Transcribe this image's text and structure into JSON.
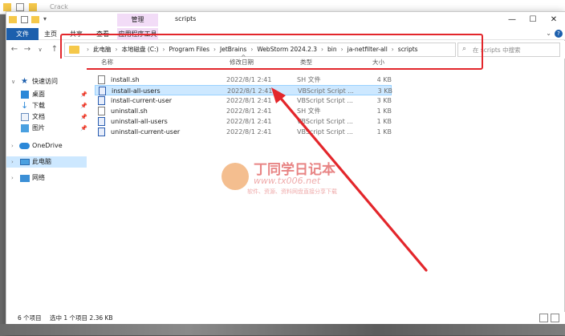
{
  "background_window": {
    "title": "Crack"
  },
  "titlebar": {
    "manage_tab": "管理",
    "title": "scripts",
    "minimize": "—",
    "maximize": "☐",
    "close": "✕"
  },
  "ribbon": {
    "tabs": [
      "文件",
      "主页",
      "共享",
      "查看",
      "应用程序工具"
    ],
    "help": "?",
    "expand": "⌄"
  },
  "address": {
    "breadcrumbs": [
      "此电脑",
      "本地磁盘 (C:)",
      "Program Files",
      "JetBrains",
      "WebStorm 2024.2.3",
      "bin",
      "ja-netfilter-all",
      "scripts"
    ],
    "search_placeholder": "在 scripts 中搜索"
  },
  "columns": {
    "name": "名称",
    "date": "修改日期",
    "type": "类型",
    "size": "大小"
  },
  "files": [
    {
      "name": "install.sh",
      "date": "2022/8/1 2:41",
      "type": "SH 文件",
      "size": "4 KB",
      "kind": "sh",
      "selected": false
    },
    {
      "name": "install-all-users",
      "date": "2022/8/1 2:41",
      "type": "VBScript Script ...",
      "size": "3 KB",
      "kind": "vbs",
      "selected": true
    },
    {
      "name": "install-current-user",
      "date": "2022/8/1 2:41",
      "type": "VBScript Script ...",
      "size": "3 KB",
      "kind": "vbs",
      "selected": false
    },
    {
      "name": "uninstall.sh",
      "date": "2022/8/1 2:41",
      "type": "SH 文件",
      "size": "1 KB",
      "kind": "sh",
      "selected": false
    },
    {
      "name": "uninstall-all-users",
      "date": "2022/8/1 2:41",
      "type": "VBScript Script ...",
      "size": "1 KB",
      "kind": "vbs",
      "selected": false
    },
    {
      "name": "uninstall-current-user",
      "date": "2022/8/1 2:41",
      "type": "VBScript Script ...",
      "size": "1 KB",
      "kind": "vbs",
      "selected": false
    }
  ],
  "nav": {
    "quick_access": "快速访问",
    "desktop": "桌面",
    "downloads": "下载",
    "documents": "文档",
    "pictures": "图片",
    "onedrive": "OneDrive",
    "this_pc": "此电脑",
    "network": "网络"
  },
  "status": {
    "count": "6 个项目",
    "selection": "选中 1 个项目  2.36 KB"
  },
  "watermark": {
    "brand": "丁同学日记本",
    "url": "www.tx006.net",
    "tagline": "软件、资源、资料网盘直接分享下载"
  },
  "colors": {
    "accent": "#1c5fad",
    "highlight": "#cde8ff",
    "annotation": "#e3262b",
    "folder": "#f5c84a"
  }
}
